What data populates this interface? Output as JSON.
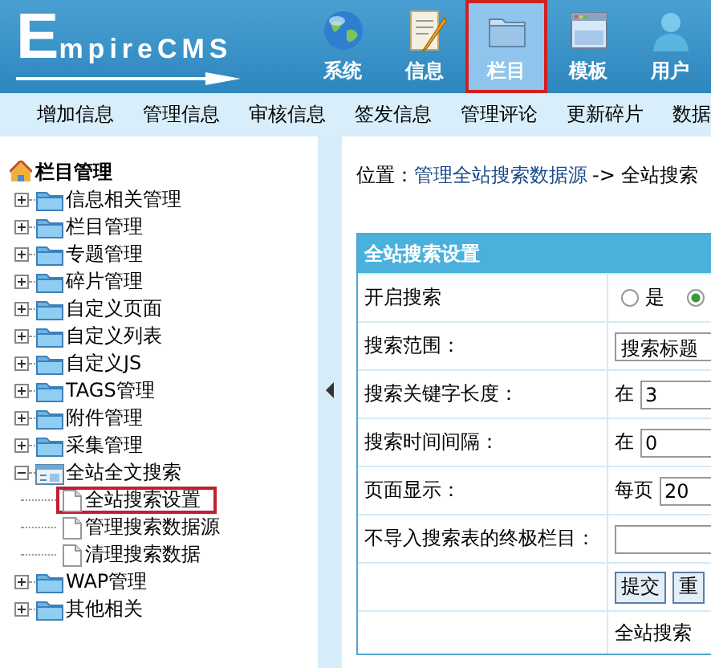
{
  "header": {
    "logo": "EmpireCMS",
    "nav": [
      {
        "label": "系统",
        "kind": "globe",
        "selected": false
      },
      {
        "label": "信息",
        "kind": "note",
        "selected": false
      },
      {
        "label": "栏目",
        "kind": "folder",
        "selected": true
      },
      {
        "label": "模板",
        "kind": "window",
        "selected": false
      },
      {
        "label": "用户",
        "kind": "user",
        "selected": false
      }
    ]
  },
  "menu": [
    "增加信息",
    "管理信息",
    "审核信息",
    "签发信息",
    "管理评论",
    "更新碎片",
    "数据"
  ],
  "sidebar": {
    "title": "栏目管理",
    "items": [
      {
        "label": "信息相关管理",
        "expanded": false
      },
      {
        "label": "栏目管理",
        "expanded": false
      },
      {
        "label": "专题管理",
        "expanded": false
      },
      {
        "label": "碎片管理",
        "expanded": false
      },
      {
        "label": "自定义页面",
        "expanded": false
      },
      {
        "label": "自定义列表",
        "expanded": false
      },
      {
        "label": "自定义JS",
        "expanded": false
      },
      {
        "label": "TAGS管理",
        "expanded": false
      },
      {
        "label": "附件管理",
        "expanded": false
      },
      {
        "label": "采集管理",
        "expanded": false
      },
      {
        "label": "全站全文搜索",
        "expanded": true,
        "children": [
          {
            "label": "全站搜索设置",
            "selected": true
          },
          {
            "label": "管理搜索数据源",
            "selected": false
          },
          {
            "label": "清理搜索数据",
            "selected": false
          }
        ]
      },
      {
        "label": "WAP管理",
        "expanded": false
      },
      {
        "label": "其他相关",
        "expanded": false
      }
    ]
  },
  "breadcrumb": {
    "label": "位置：",
    "link": "管理全站搜索数据源",
    "current": "-> 全站搜索"
  },
  "form": {
    "title": "全站搜索设置",
    "rows": [
      {
        "kind": "radio",
        "label": "开启搜索",
        "options": [
          {
            "label": "是",
            "selected": false
          },
          {
            "selected": true
          }
        ]
      },
      {
        "kind": "select",
        "label": "搜索范围：",
        "value": "搜索标题"
      },
      {
        "kind": "text",
        "label": "搜索关键字长度：",
        "prefix": "在",
        "value": "3"
      },
      {
        "kind": "text",
        "label": "搜索时间间隔：",
        "prefix": "在",
        "value": "0"
      },
      {
        "kind": "text",
        "label": "页面显示：",
        "prefix": "每页",
        "value": "20"
      },
      {
        "kind": "text",
        "label": "不导入搜索表的终极栏目："
      },
      {
        "kind": "buttons",
        "buttons": [
          "提交",
          "重"
        ]
      },
      {
        "kind": "note",
        "text": "全站搜索"
      }
    ]
  }
}
